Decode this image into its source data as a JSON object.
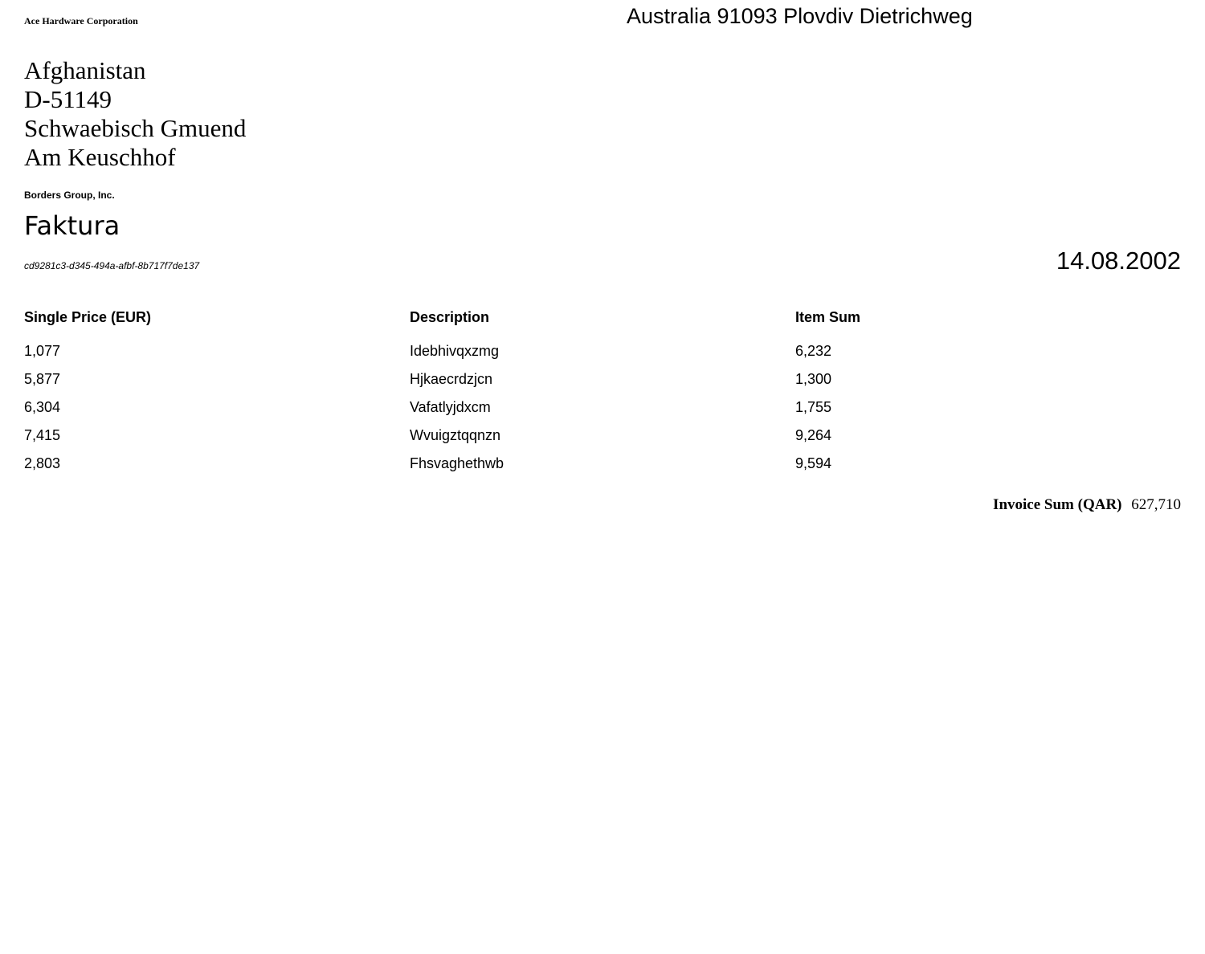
{
  "sender": {
    "company": "Ace Hardware Corporation",
    "address_line": "Australia 91093 Plovdiv Dietrichweg"
  },
  "recipient": {
    "lines": [
      "Afghanistan",
      "D-51149",
      "Schwaebisch Gmuend",
      "Am Keuschhof"
    ]
  },
  "customer_company": "Borders Group, Inc.",
  "document": {
    "title": "Faktura",
    "invoice_id": "cd9281c3-d345-494a-afbf-8b717f7de137",
    "date": "14.08.2002"
  },
  "table": {
    "headers": [
      "Single Price (EUR)",
      "Description",
      "Item Sum"
    ],
    "rows": [
      [
        "1,077",
        "Idebhivqxzmg",
        "6,232"
      ],
      [
        "5,877",
        "Hjkaecrdzjcn",
        "1,300"
      ],
      [
        "6,304",
        "Vafatlyjdxcm",
        "1,755"
      ],
      [
        "7,415",
        "Wvuigztqqnzn",
        "9,264"
      ],
      [
        "2,803",
        "Fhsvaghethwb",
        "9,594"
      ]
    ]
  },
  "total": {
    "label": "Invoice Sum (QAR)",
    "value": "627,710"
  }
}
